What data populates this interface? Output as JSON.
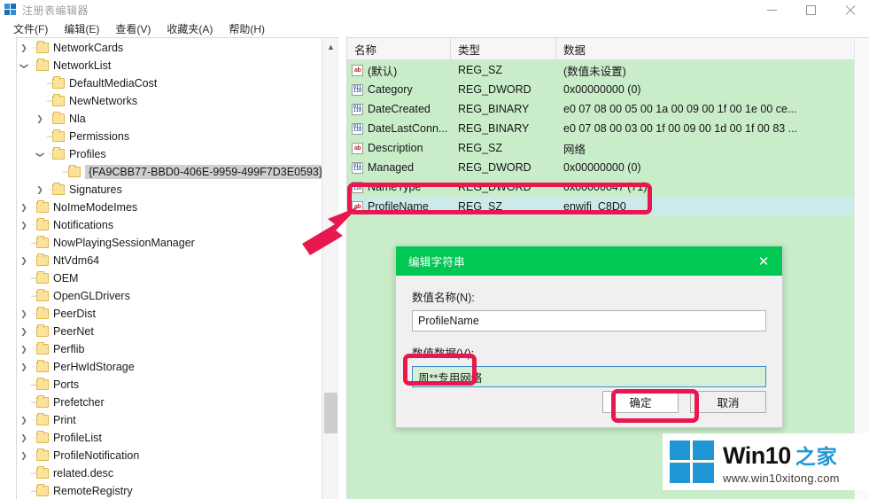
{
  "window": {
    "title": "注册表编辑器",
    "icon": "registry-editor-icon",
    "controls": {
      "minimize": "minimize-icon",
      "maximize": "maximize-icon",
      "close": "close-icon"
    }
  },
  "menu": {
    "items": [
      {
        "label": "文件(F)"
      },
      {
        "label": "编辑(E)"
      },
      {
        "label": "查看(V)"
      },
      {
        "label": "收藏夹(A)"
      },
      {
        "label": "帮助(H)"
      }
    ]
  },
  "tree": {
    "items": [
      {
        "label": "NetworkCards",
        "indent": 0,
        "twist": "collapsed"
      },
      {
        "label": "NetworkList",
        "indent": 0,
        "twist": "expanded"
      },
      {
        "label": "DefaultMediaCost",
        "indent": 1,
        "twist": "none"
      },
      {
        "label": "NewNetworks",
        "indent": 1,
        "twist": "none"
      },
      {
        "label": "Nla",
        "indent": 1,
        "twist": "collapsed"
      },
      {
        "label": "Permissions",
        "indent": 1,
        "twist": "none"
      },
      {
        "label": "Profiles",
        "indent": 1,
        "twist": "expanded"
      },
      {
        "label": "{FA9CBB77-BBD0-406E-9959-499F7D3E0593}",
        "indent": 2,
        "twist": "none",
        "selected": true
      },
      {
        "label": "Signatures",
        "indent": 1,
        "twist": "collapsed"
      },
      {
        "label": "NoImeModeImes",
        "indent": 0,
        "twist": "collapsed"
      },
      {
        "label": "Notifications",
        "indent": 0,
        "twist": "collapsed"
      },
      {
        "label": "NowPlayingSessionManager",
        "indent": 0,
        "twist": "none"
      },
      {
        "label": "NtVdm64",
        "indent": 0,
        "twist": "collapsed"
      },
      {
        "label": "OEM",
        "indent": 0,
        "twist": "none"
      },
      {
        "label": "OpenGLDrivers",
        "indent": 0,
        "twist": "none"
      },
      {
        "label": "PeerDist",
        "indent": 0,
        "twist": "collapsed"
      },
      {
        "label": "PeerNet",
        "indent": 0,
        "twist": "collapsed"
      },
      {
        "label": "Perflib",
        "indent": 0,
        "twist": "collapsed"
      },
      {
        "label": "PerHwIdStorage",
        "indent": 0,
        "twist": "collapsed"
      },
      {
        "label": "Ports",
        "indent": 0,
        "twist": "none"
      },
      {
        "label": "Prefetcher",
        "indent": 0,
        "twist": "none"
      },
      {
        "label": "Print",
        "indent": 0,
        "twist": "collapsed"
      },
      {
        "label": "ProfileList",
        "indent": 0,
        "twist": "collapsed"
      },
      {
        "label": "ProfileNotification",
        "indent": 0,
        "twist": "collapsed"
      },
      {
        "label": "related.desc",
        "indent": 0,
        "twist": "none"
      },
      {
        "label": "RemoteRegistry",
        "indent": 0,
        "twist": "none"
      }
    ],
    "scrollbar": {
      "up": "chevron-up-icon",
      "down": "chevron-down-icon"
    }
  },
  "list": {
    "columns": [
      {
        "label": "名称"
      },
      {
        "label": "类型"
      },
      {
        "label": "数据"
      }
    ],
    "rows": [
      {
        "icon": "string-value-icon",
        "kind": "sz",
        "name": "(默认)",
        "type": "REG_SZ",
        "data": "(数值未设置)"
      },
      {
        "icon": "binary-value-icon",
        "kind": "num",
        "name": "Category",
        "type": "REG_DWORD",
        "data": "0x00000000 (0)"
      },
      {
        "icon": "binary-value-icon",
        "kind": "num",
        "name": "DateCreated",
        "type": "REG_BINARY",
        "data": "e0 07 08 00 05 00 1a 00 09 00 1f 00 1e 00 ce..."
      },
      {
        "icon": "binary-value-icon",
        "kind": "num",
        "name": "DateLastConn...",
        "type": "REG_BINARY",
        "data": "e0 07 08 00 03 00 1f 00 09 00 1d 00 1f 00 83 ..."
      },
      {
        "icon": "string-value-icon",
        "kind": "sz",
        "name": "Description",
        "type": "REG_SZ",
        "data": "网络"
      },
      {
        "icon": "binary-value-icon",
        "kind": "num",
        "name": "Managed",
        "type": "REG_DWORD",
        "data": "0x00000000 (0)"
      },
      {
        "icon": "binary-value-icon",
        "kind": "num",
        "name": "NameType",
        "type": "REG_DWORD",
        "data": "0x00000047 (71)"
      },
      {
        "icon": "string-value-icon",
        "kind": "sz",
        "name": "ProfileName",
        "type": "REG_SZ",
        "data": "enwifi_C8D0",
        "selected": true
      }
    ]
  },
  "dialog": {
    "title": "编辑字符串",
    "close": "close-icon",
    "name_label": "数值名称(N):",
    "name_value": "ProfileName",
    "data_label": "数值数据(V):",
    "data_value": "周**专用网络",
    "ok_label": "确定",
    "cancel_label": "取消"
  },
  "annotations": {
    "arrow": "red-arrow-pointer",
    "highlight_color": "#e8174e"
  },
  "watermark": {
    "brand": "Win10",
    "brand_cn": "之家",
    "url": "www.win10xitong.com",
    "logo": "windows-logo-icon"
  }
}
